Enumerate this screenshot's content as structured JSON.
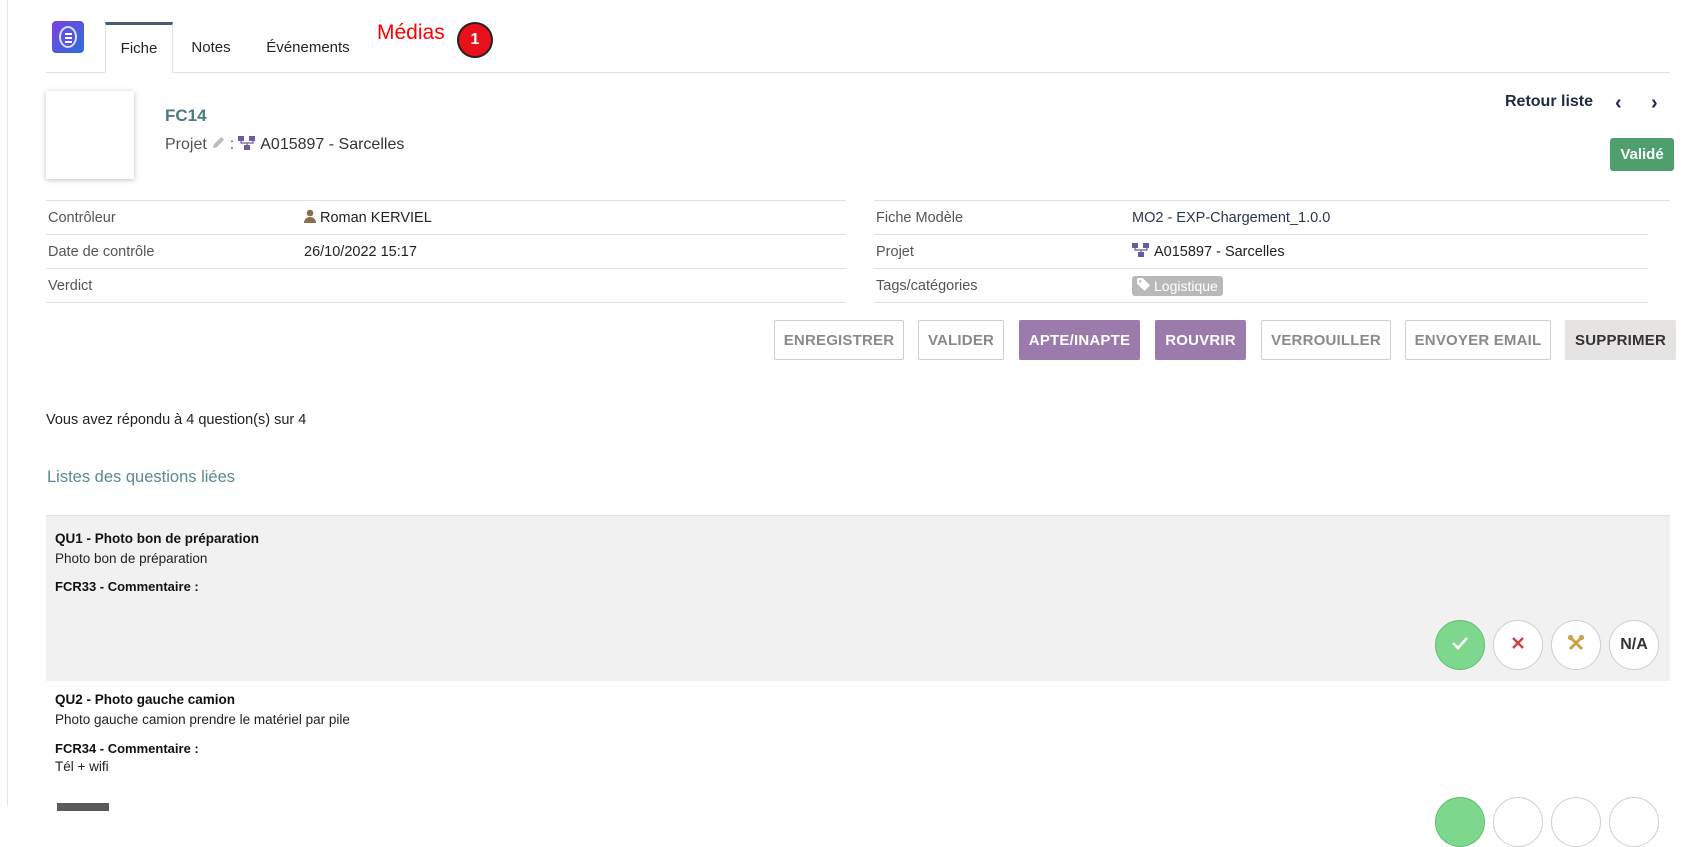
{
  "tabs": {
    "fiche": "Fiche",
    "notes": "Notes",
    "events": "Événements",
    "medias": "Médias",
    "medias_badge": "1"
  },
  "header": {
    "code": "FC14",
    "project_label": "Projet",
    "project_sep": ":",
    "project_value": "A015897 - Sarcelles",
    "back_label": "Retour liste",
    "prev_glyph": "‹",
    "next_glyph": "›",
    "status": "Validé"
  },
  "info_left": [
    {
      "label": "Contrôleur",
      "value": "Roman KERVIEL",
      "icon": "user-icon"
    },
    {
      "label": "Date de contrôle",
      "value": "26/10/2022 15:17"
    },
    {
      "label": "Verdict",
      "value": ""
    }
  ],
  "info_right": [
    {
      "label": "Fiche Modèle",
      "value": "MO2 - EXP-Chargement_1.0.0"
    },
    {
      "label": "Projet",
      "value": "A015897 - Sarcelles",
      "icon": "project-tree-icon"
    },
    {
      "label": "Tags/catégories",
      "value": "Logistique",
      "icon": "tag-icon"
    }
  ],
  "actions": {
    "enregistrer": "ENREGISTRER",
    "valider": "VALIDER",
    "apte": "APTE/INAPTE",
    "rouvrir": "ROUVRIR",
    "verrouiller": "VERROUILLER",
    "email": "ENVOYER EMAIL",
    "supprimer": "SUPPRIMER"
  },
  "answered_text": "Vous avez répondu à 4 question(s) sur 4",
  "linked_title": "Listes des questions liées",
  "questions": [
    {
      "title": "QU1 - Photo bon de préparation",
      "desc": "Photo bon de préparation",
      "comment_label": "FCR33 - Commentaire :",
      "comment_value": "",
      "na": "N/A"
    },
    {
      "title": "QU2 - Photo gauche camion",
      "desc": "Photo gauche camion prendre le matériel par pile",
      "comment_label": "FCR34 - Commentaire :",
      "comment_value": "Tél + wifi"
    }
  ],
  "colors": {
    "status_green": "#4f9e6e",
    "purple_button": "#9a7bab",
    "ok_green": "#7dd88e",
    "annotation_red": "#ff0000"
  }
}
